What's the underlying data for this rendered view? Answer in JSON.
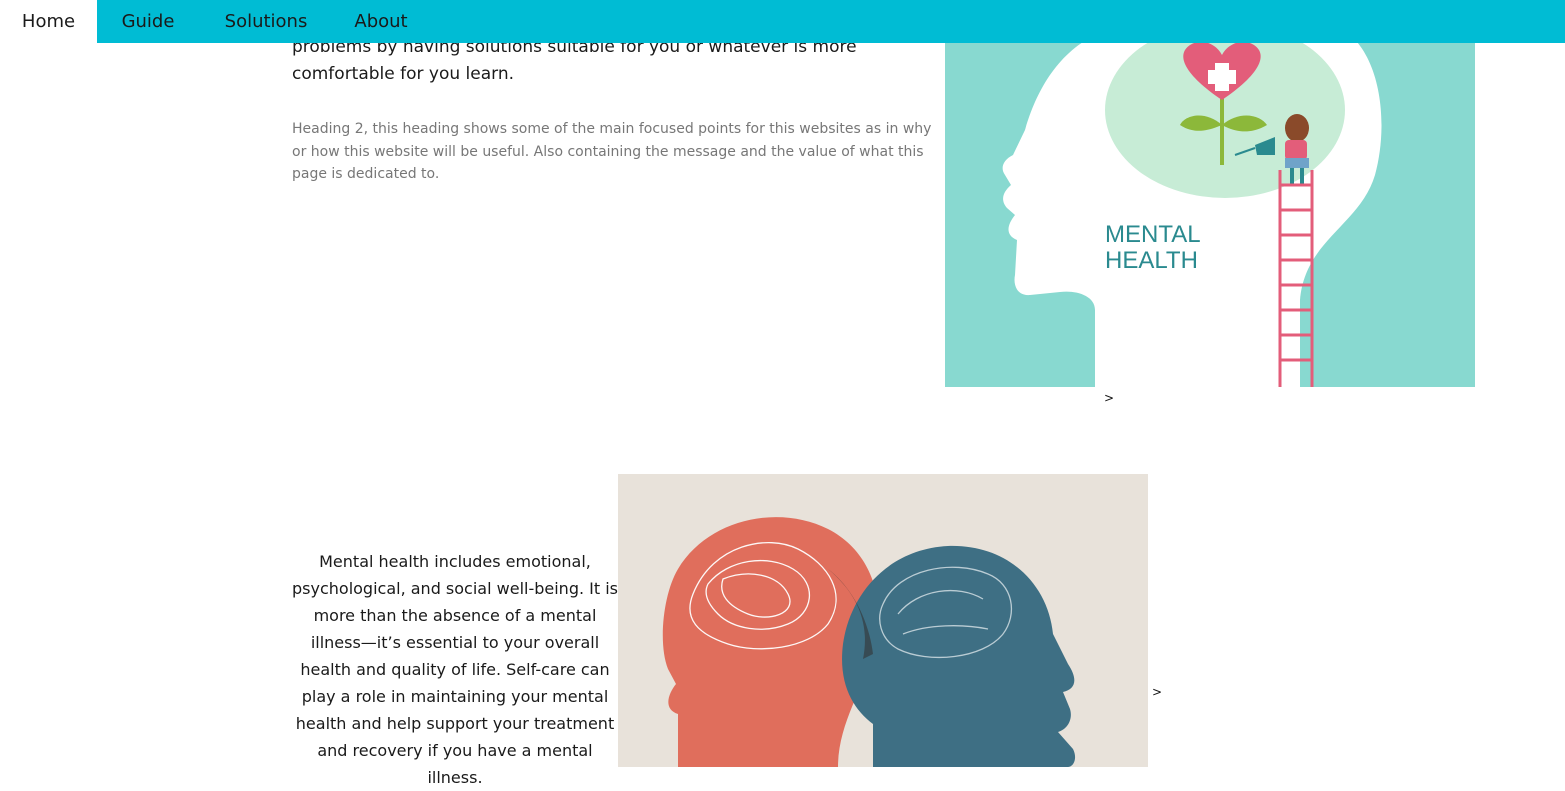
{
  "nav": {
    "items": [
      {
        "label": "Home"
      },
      {
        "label": "Guide"
      },
      {
        "label": "Solutions"
      },
      {
        "label": "About"
      }
    ]
  },
  "intro": {
    "text": "problems by having solutions suitable for you or whatever is more comfortable for you learn."
  },
  "heading2": {
    "text": "Heading 2, this heading shows some of the main focused points for this websites as in why or how this website will be useful. Also containing the message and the value of what this page is dedicated to."
  },
  "figure1": {
    "title_line1": "MENTAL",
    "title_line2": "HEALTH",
    "bg_color": "#88d9d0",
    "accent_color": "#e35d7a",
    "caption_arrow": ">"
  },
  "section2": {
    "text": "Mental health includes emotional, psychological, and social well-being. It is more than the absence of a mental illness—it’s essential to your overall health and quality of life. Self-care can play a role in maintaining your mental health and help support your treatment and recovery if you have a mental illness.",
    "caption_arrow": ">"
  },
  "colors": {
    "nav_bg": "#00bcd4",
    "active_tab_bg": "#ffffff",
    "body_text": "#1a1a1a",
    "muted_text": "#777777",
    "head_orange": "#e06e5c",
    "head_blue": "#3e6f84",
    "figure2_bg": "#e8e2da"
  }
}
